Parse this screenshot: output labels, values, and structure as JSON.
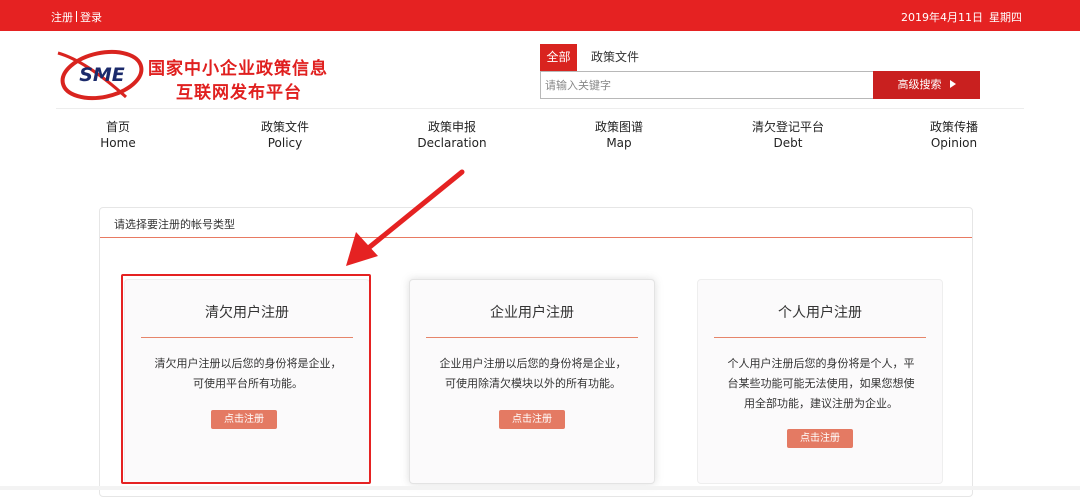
{
  "topbar": {
    "register": "注册",
    "login": "登录",
    "date": "2019年4月11日",
    "weekday": "星期四"
  },
  "logo": {
    "badge": "SME",
    "line1": "国家中小企业政策信息",
    "line2": "互联网发布平台"
  },
  "search": {
    "tabs": [
      "全部",
      "政策文件"
    ],
    "placeholder": "请输入关键字",
    "advanced_label": "高级搜索"
  },
  "nav": [
    {
      "cn": "首页",
      "en": "Home"
    },
    {
      "cn": "政策文件",
      "en": "Policy"
    },
    {
      "cn": "政策申报",
      "en": "Declaration"
    },
    {
      "cn": "政策图谱",
      "en": "Map"
    },
    {
      "cn": "清欠登记平台",
      "en": "Debt"
    },
    {
      "cn": "政策传播",
      "en": "Opinion"
    }
  ],
  "panel": {
    "title": "请选择要注册的帐号类型"
  },
  "cards": [
    {
      "title": "清欠用户注册",
      "desc": [
        "清欠用户注册以后您的身份将是企业，",
        "可使用平台所有功能。"
      ],
      "button": "点击注册"
    },
    {
      "title": "企业用户注册",
      "desc": [
        "企业用户注册以后您的身份将是企业，",
        "可使用除清欠模块以外的所有功能。"
      ],
      "button": "点击注册"
    },
    {
      "title": "个人用户注册",
      "desc": [
        "个人用户注册后您的身份将是个人，平",
        "台某些功能可能无法使用，如果您想使",
        "用全部功能，建议注册为企业。"
      ],
      "button": "点击注册"
    }
  ],
  "colors": {
    "brand_red": "#e52222",
    "accent_salmon": "#e47a63"
  }
}
